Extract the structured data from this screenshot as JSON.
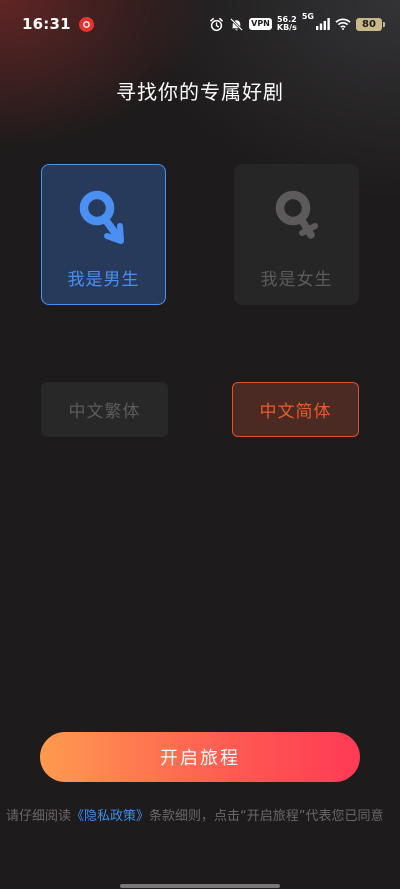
{
  "status_bar": {
    "time": "16:31",
    "vpn": "VPN",
    "net_speed_value": "56.2",
    "net_speed_unit": "KB/s",
    "network": "5G",
    "battery": "80"
  },
  "title": "寻找你的专属好剧",
  "gender_options": {
    "male_label": "我是男生",
    "female_label": "我是女生",
    "selected": "male"
  },
  "language_options": {
    "traditional_label": "中文繁体",
    "simplified_label": "中文简体",
    "selected": "simplified"
  },
  "start_button_label": "开启旅程",
  "agreement": {
    "prefix": "请仔细阅读",
    "link": "《隐私政策》",
    "suffix": "条款细则，点击“开启旅程”代表您已同意"
  },
  "colors": {
    "male_accent": "#4b8ff0",
    "simplified_accent": "#ec5b2e",
    "button_gradient_start": "#ff9a4f",
    "button_gradient_end": "#ff3a55",
    "background": "#1d1b1b"
  }
}
